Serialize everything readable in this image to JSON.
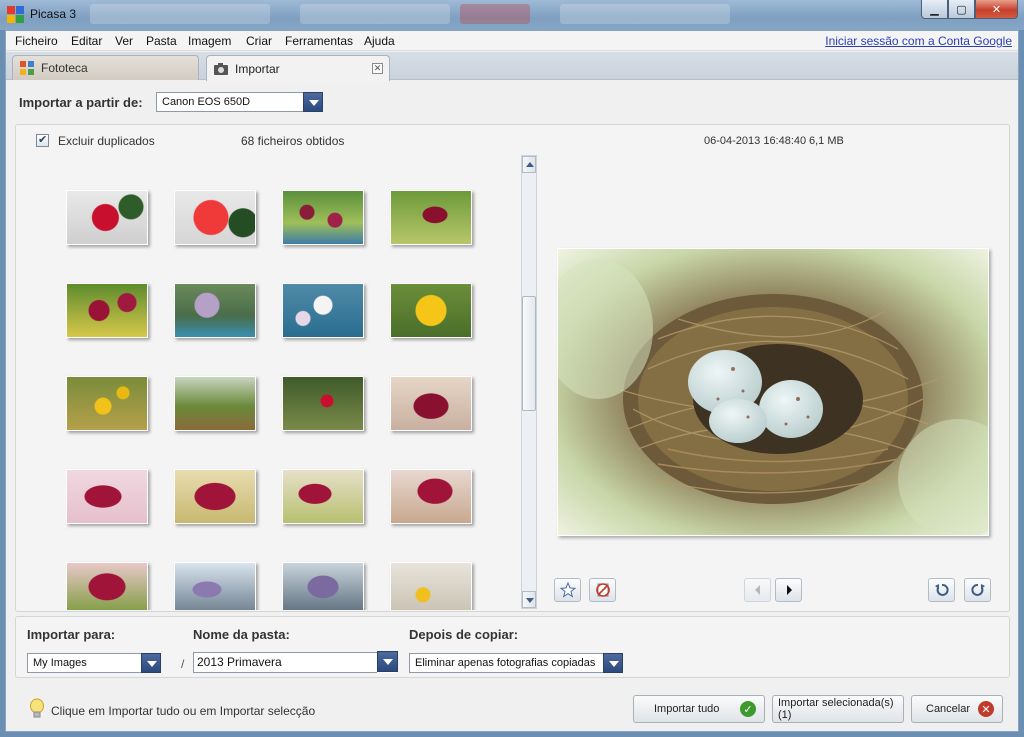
{
  "window": {
    "title": "Picasa 3"
  },
  "menu": {
    "items": [
      "Ficheiro",
      "Editar",
      "Ver",
      "Pasta",
      "Imagem",
      "Criar",
      "Ferramentas",
      "Ajuda"
    ],
    "signin": "Iniciar sessão com a Conta Google"
  },
  "tabs": [
    {
      "label": "Fototeca",
      "icon": "photo-library-icon"
    },
    {
      "label": "Importar",
      "icon": "camera-import-icon"
    }
  ],
  "import_source": {
    "label": "Importar a partir de:",
    "selected": "Canon EOS 650D"
  },
  "panel": {
    "exclude_duplicates_label": "Excluir duplicados",
    "exclude_duplicates_checked": true,
    "files_count": "68 ficheiros obtidos",
    "photo_date": "06-04-2013 16:48:40",
    "photo_size": "6,1 MB"
  },
  "destination": {
    "import_to_label": "Importar para:",
    "import_to_value": "My Images",
    "folder_name_label": "Nome da pasta:",
    "folder_name_value": "2013 Primavera",
    "after_copy_label": "Depois de copiar:",
    "after_copy_value": "Eliminar apenas fotografias copiadas"
  },
  "bottom": {
    "hint": "Clique em Importar tudo ou em Importar selecção",
    "import_all": "Importar tudo",
    "import_selected": "Importar selecionada(s) (1)",
    "cancel": "Cancelar"
  },
  "colors": {
    "accent": "#2c4a7d",
    "link": "#2a3fb2",
    "ok_green": "#3f9a2e",
    "cancel_red": "#c0392b"
  }
}
